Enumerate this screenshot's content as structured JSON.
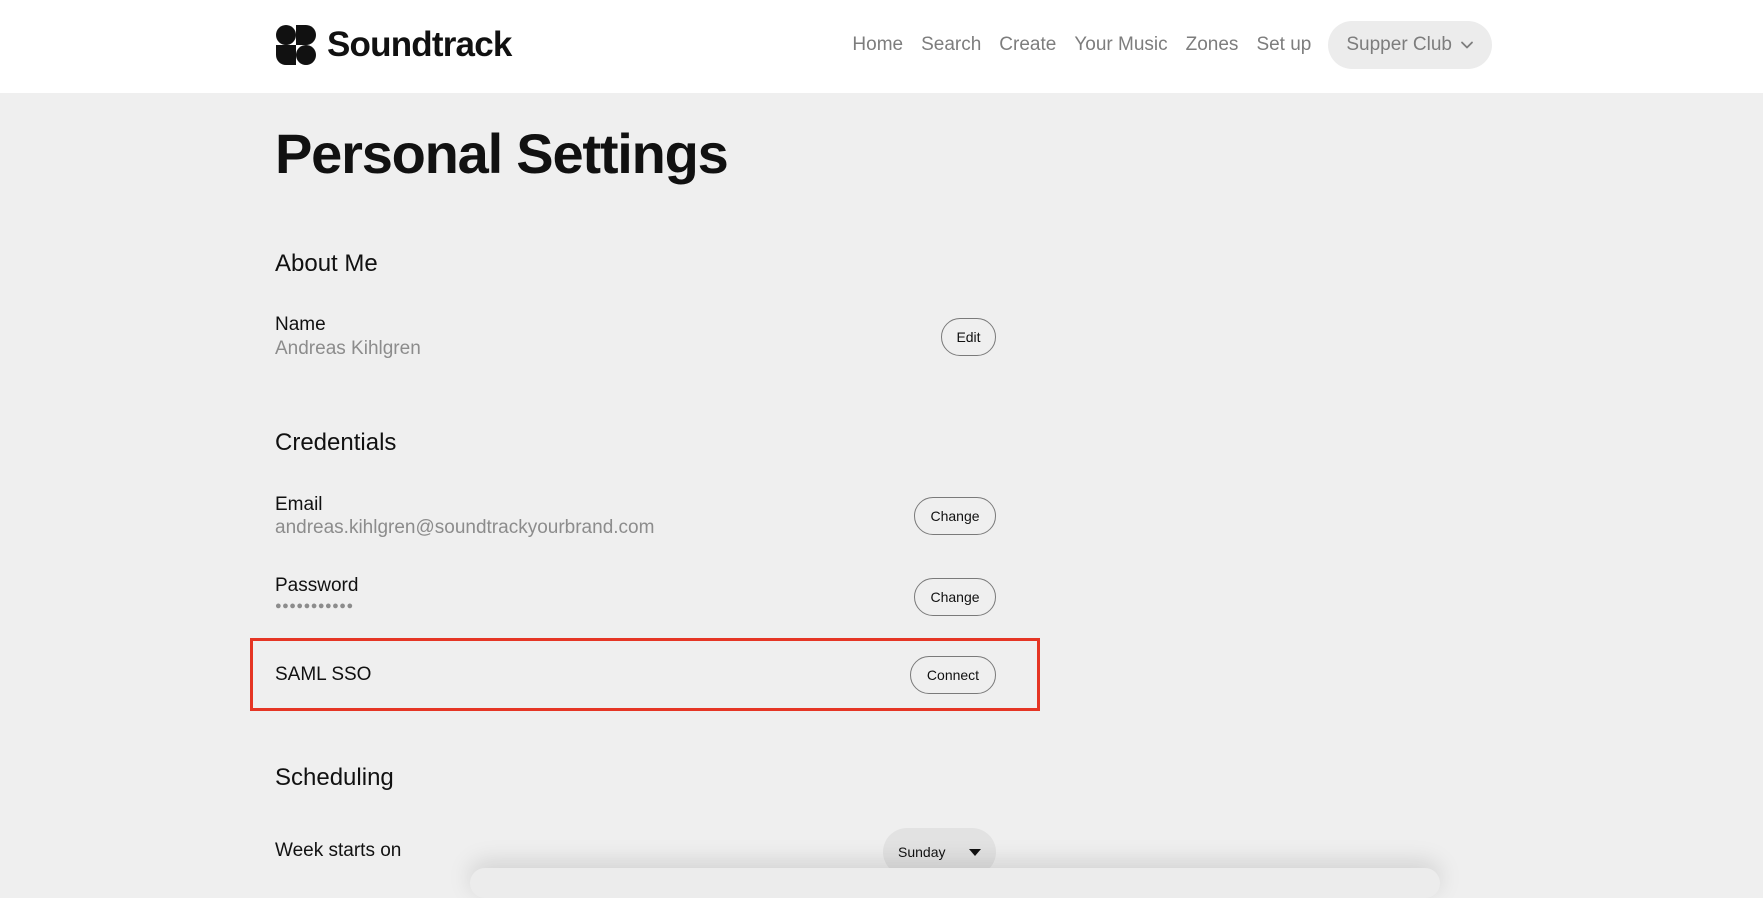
{
  "brand": {
    "name": "Soundtrack"
  },
  "nav": {
    "items": [
      {
        "label": "Home"
      },
      {
        "label": "Search"
      },
      {
        "label": "Create"
      },
      {
        "label": "Your Music"
      },
      {
        "label": "Zones"
      },
      {
        "label": "Set up"
      }
    ],
    "account": {
      "label": "Supper Club",
      "icon": "chevron-down-icon"
    }
  },
  "page": {
    "title": "Personal Settings"
  },
  "about_me": {
    "title": "About Me",
    "name_label": "Name",
    "name_value": "Andreas Kihlgren",
    "edit_label": "Edit"
  },
  "credentials": {
    "title": "Credentials",
    "email_label": "Email",
    "email_value": "andreas.kihlgren@soundtrackyourbrand.com",
    "email_change_label": "Change",
    "password_label": "Password",
    "password_value": "●●●●●●●●●●●",
    "password_change_label": "Change",
    "saml_label": "SAML SSO",
    "saml_connect_label": "Connect"
  },
  "scheduling": {
    "title": "Scheduling",
    "week_start_label": "Week starts on",
    "week_start_value": "Sunday"
  },
  "colors": {
    "page_bg": "#efefef",
    "header_bg": "#ffffff",
    "highlight_border": "#e53524",
    "muted_text": "#8c8c8c",
    "nav_text": "#7d7d7d"
  }
}
